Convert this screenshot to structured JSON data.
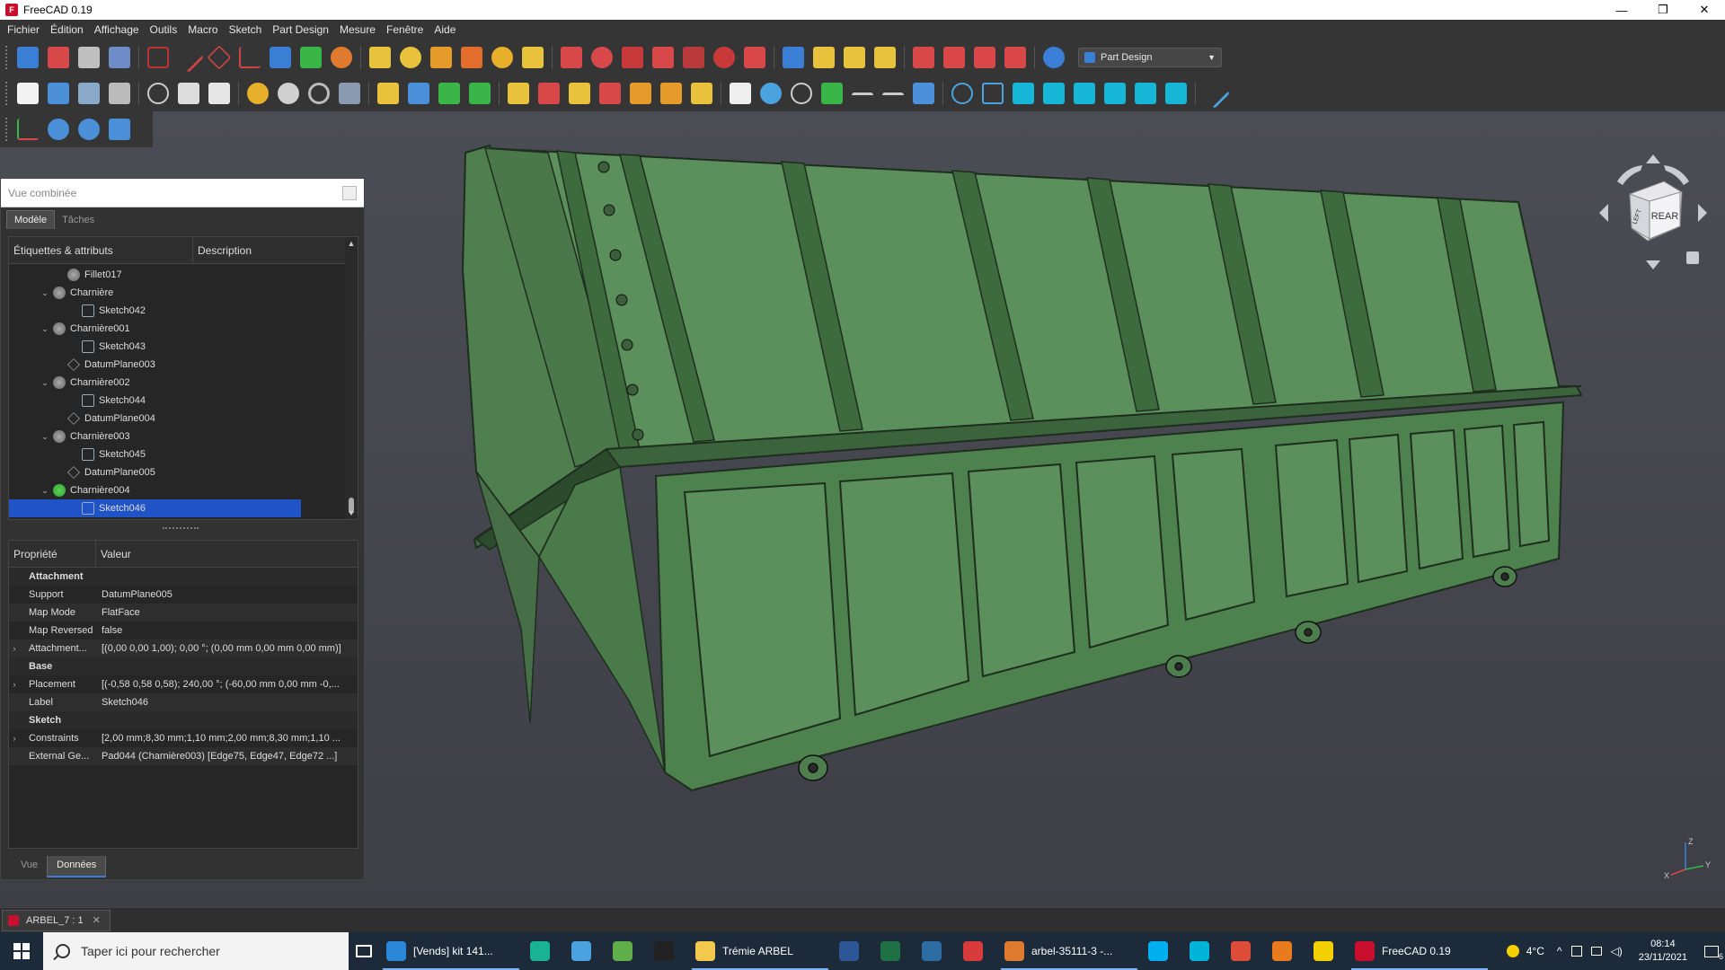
{
  "window": {
    "title": "FreeCAD 0.19",
    "app_icon": "freecad-icon",
    "controls": [
      "—",
      "❐",
      "✕"
    ]
  },
  "menu": [
    "Fichier",
    "Édition",
    "Affichage",
    "Outils",
    "Macro",
    "Sketch",
    "Part Design",
    "Mesure",
    "Fenêtre",
    "Aide"
  ],
  "workbench": {
    "selected": "Part Design"
  },
  "combo_view": {
    "title": "Vue combinée",
    "tabs": [
      "Modèle",
      "Tâches"
    ],
    "active_tab": "Modèle",
    "tree_columns": [
      "Étiquettes & attributs",
      "Description"
    ],
    "tree": [
      {
        "label": "Fillet017",
        "type": "body",
        "depth": 2,
        "expand": ""
      },
      {
        "label": "Charnière",
        "type": "body",
        "depth": 1,
        "expand": "v"
      },
      {
        "label": "Sketch042",
        "type": "sketch",
        "depth": 3,
        "expand": ""
      },
      {
        "label": "Charnière001",
        "type": "body",
        "depth": 1,
        "expand": "v"
      },
      {
        "label": "Sketch043",
        "type": "sketch",
        "depth": 3,
        "expand": ""
      },
      {
        "label": "DatumPlane003",
        "type": "datum",
        "depth": 2,
        "expand": ""
      },
      {
        "label": "Charnière002",
        "type": "body",
        "depth": 1,
        "expand": "v"
      },
      {
        "label": "Sketch044",
        "type": "sketch",
        "depth": 3,
        "expand": ""
      },
      {
        "label": "DatumPlane004",
        "type": "datum",
        "depth": 2,
        "expand": ""
      },
      {
        "label": "Charnière003",
        "type": "body",
        "depth": 1,
        "expand": "v"
      },
      {
        "label": "Sketch045",
        "type": "sketch",
        "depth": 3,
        "expand": ""
      },
      {
        "label": "DatumPlane005",
        "type": "datum",
        "depth": 2,
        "expand": ""
      },
      {
        "label": "Charnière004",
        "type": "body-active",
        "depth": 1,
        "expand": "v"
      },
      {
        "label": "Sketch046",
        "type": "sketch",
        "depth": 3,
        "expand": "",
        "selected": true
      }
    ],
    "prop_columns": [
      "Propriété",
      "Valeur"
    ],
    "properties": [
      {
        "group": "Attachment"
      },
      {
        "name": "Support",
        "value": "DatumPlane005"
      },
      {
        "name": "Map Mode",
        "value": "FlatFace"
      },
      {
        "name": "Map Reversed",
        "value": "false"
      },
      {
        "name": "Attachment...",
        "value": "[(0,00 0,00 1,00); 0,00 °; (0,00 mm  0,00 mm  0,00 mm)]",
        "expandable": true
      },
      {
        "group": "Base"
      },
      {
        "name": "Placement",
        "value": "[(-0,58 0,58 0,58); 240,00 °; (-60,00 mm  0,00 mm  -0,...",
        "expandable": true
      },
      {
        "name": "Label",
        "value": "Sketch046"
      },
      {
        "group": "Sketch"
      },
      {
        "name": "Constraints",
        "value": "[2,00 mm;8,30 mm;1,10 mm;2,00 mm;8,30 mm;1,10 ...",
        "expandable": true
      },
      {
        "name": "External Ge...",
        "value": "Pad044 (Charnière003) [Edge75, Edge47, Edge72 ...]"
      }
    ],
    "bottom_tabs": [
      "Vue",
      "Données"
    ],
    "active_bottom_tab": "Données"
  },
  "navcube": {
    "face_label": "REAR",
    "side_label": "LEFT",
    "axis_labels": [
      "Z",
      "X",
      "Y"
    ]
  },
  "document_tab": {
    "label": "ARBEL_7 : 1"
  },
  "taskbar": {
    "search_placeholder": "Taper ici pour rechercher",
    "apps": [
      {
        "name": "edge",
        "label": "[Vends] kit 141...",
        "color": "#2b88d8",
        "active": true
      },
      {
        "name": "app-teal",
        "label": "",
        "color": "#19b394"
      },
      {
        "name": "app-plane",
        "label": "",
        "color": "#4aa3df"
      },
      {
        "name": "app-chart",
        "label": "",
        "color": "#5fae4a"
      },
      {
        "name": "7zip",
        "label": "",
        "color": "#222222"
      },
      {
        "name": "explorer",
        "label": "Trémie ARBEL",
        "color": "#f2c94c",
        "active": true
      },
      {
        "name": "word",
        "label": "",
        "color": "#2b5797"
      },
      {
        "name": "excel",
        "label": "",
        "color": "#1e7145"
      },
      {
        "name": "app-k",
        "label": "",
        "color": "#2d6ca2"
      },
      {
        "name": "app-red",
        "label": "",
        "color": "#d83b3b"
      },
      {
        "name": "arbel",
        "label": "arbel-35111-3 -...",
        "color": "#e07a2e",
        "active": true
      },
      {
        "name": "skype",
        "label": "",
        "color": "#00aff0"
      },
      {
        "name": "app-wave",
        "label": "",
        "color": "#00b4d8"
      },
      {
        "name": "chrome",
        "label": "",
        "color": "#dd4b39"
      },
      {
        "name": "app-f",
        "label": "",
        "color": "#e87b1e"
      },
      {
        "name": "app-yellow",
        "label": "",
        "color": "#f4d000"
      },
      {
        "name": "freecad",
        "label": "FreeCAD 0.19",
        "color": "#c8102e",
        "active": true
      }
    ],
    "weather": "4°C",
    "time": "08:14",
    "date": "23/11/2021",
    "notifications": "6"
  },
  "colors": {
    "accent": "#2053c6",
    "model_green": "#5a8f5a",
    "viewport_bg": "#45474e"
  }
}
